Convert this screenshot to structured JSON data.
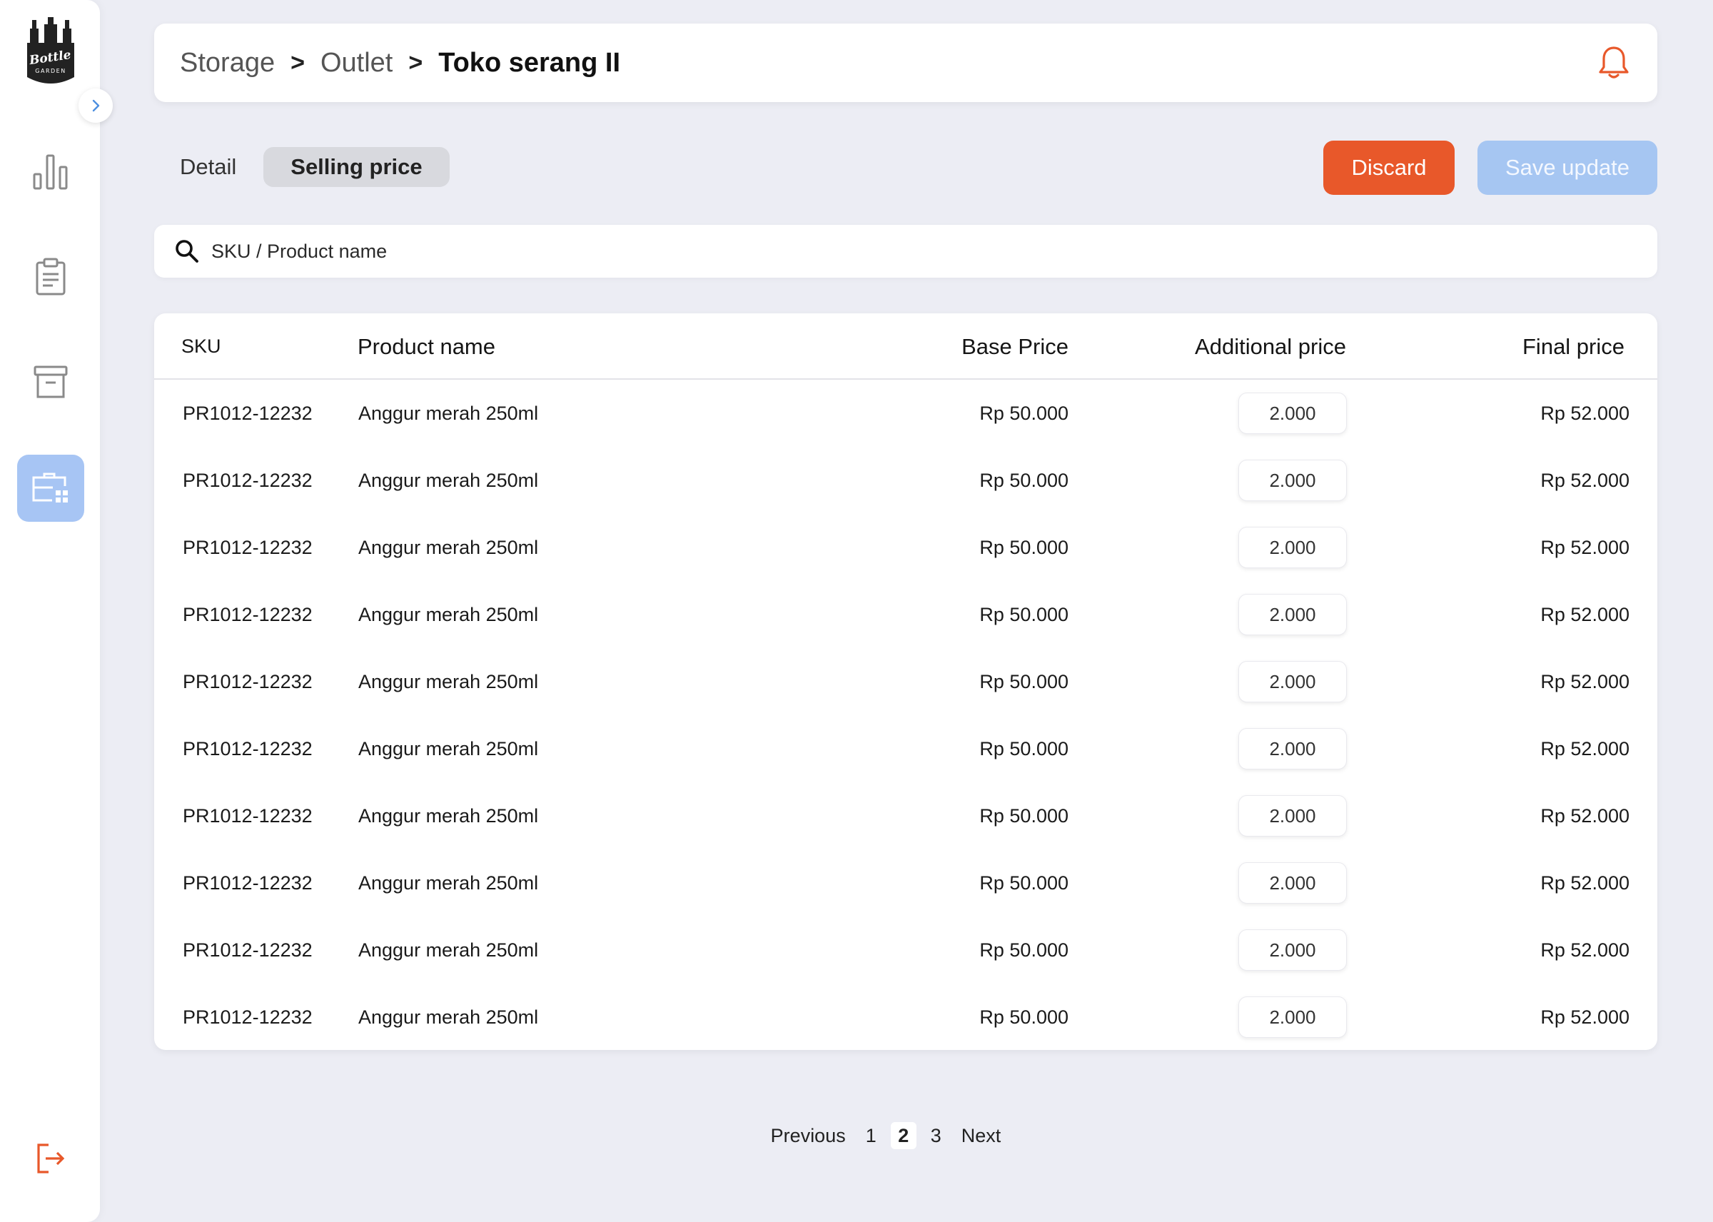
{
  "app": {
    "logo_text": "Bottle GARDEN"
  },
  "sidebar": {
    "items": [
      {
        "name": "analytics",
        "icon": "bar-chart-icon",
        "active": false
      },
      {
        "name": "orders",
        "icon": "clipboard-icon",
        "active": false
      },
      {
        "name": "archive",
        "icon": "archive-box-icon",
        "active": false
      },
      {
        "name": "outlet",
        "icon": "store-grid-icon",
        "active": true
      }
    ],
    "logout_icon": "logout-icon",
    "collapse_icon": "chevron-right-icon"
  },
  "header": {
    "breadcrumb": [
      "Storage",
      "Outlet",
      "Toko serang II"
    ],
    "separator": ">",
    "notification_icon": "bell-icon"
  },
  "tabs": [
    {
      "label": "Detail",
      "active": false
    },
    {
      "label": "Selling price",
      "active": true
    }
  ],
  "actions": {
    "discard_label": "Discard",
    "save_label": "Save update"
  },
  "search": {
    "placeholder": "SKU / Product name",
    "icon": "search-icon"
  },
  "table": {
    "columns": [
      "SKU",
      "Product name",
      "Base Price",
      "Additional price",
      "Final price"
    ],
    "rows": [
      {
        "sku": "PR1012-12232",
        "name": "Anggur merah 250ml",
        "base": "Rp 50.000",
        "additional": "2.000",
        "final": "Rp 52.000"
      },
      {
        "sku": "PR1012-12232",
        "name": "Anggur merah 250ml",
        "base": "Rp 50.000",
        "additional": "2.000",
        "final": "Rp 52.000"
      },
      {
        "sku": "PR1012-12232",
        "name": "Anggur merah 250ml",
        "base": "Rp 50.000",
        "additional": "2.000",
        "final": "Rp 52.000"
      },
      {
        "sku": "PR1012-12232",
        "name": "Anggur merah 250ml",
        "base": "Rp 50.000",
        "additional": "2.000",
        "final": "Rp 52.000"
      },
      {
        "sku": "PR1012-12232",
        "name": "Anggur merah 250ml",
        "base": "Rp 50.000",
        "additional": "2.000",
        "final": "Rp 52.000"
      },
      {
        "sku": "PR1012-12232",
        "name": "Anggur merah 250ml",
        "base": "Rp 50.000",
        "additional": "2.000",
        "final": "Rp 52.000"
      },
      {
        "sku": "PR1012-12232",
        "name": "Anggur merah 250ml",
        "base": "Rp 50.000",
        "additional": "2.000",
        "final": "Rp 52.000"
      },
      {
        "sku": "PR1012-12232",
        "name": "Anggur merah 250ml",
        "base": "Rp 50.000",
        "additional": "2.000",
        "final": "Rp 52.000"
      },
      {
        "sku": "PR1012-12232",
        "name": "Anggur merah 250ml",
        "base": "Rp 50.000",
        "additional": "2.000",
        "final": "Rp 52.000"
      },
      {
        "sku": "PR1012-12232",
        "name": "Anggur merah 250ml",
        "base": "Rp 50.000",
        "additional": "2.000",
        "final": "Rp 52.000"
      }
    ]
  },
  "pagination": {
    "previous_label": "Previous",
    "pages": [
      "1",
      "2",
      "3"
    ],
    "current_page": "2",
    "next_label": "Next"
  },
  "colors": {
    "accent_orange": "#e8582a",
    "save_disabled_blue": "#a6c6f2",
    "active_nav_blue": "#a7c5f4",
    "background": "#ecedf4"
  }
}
